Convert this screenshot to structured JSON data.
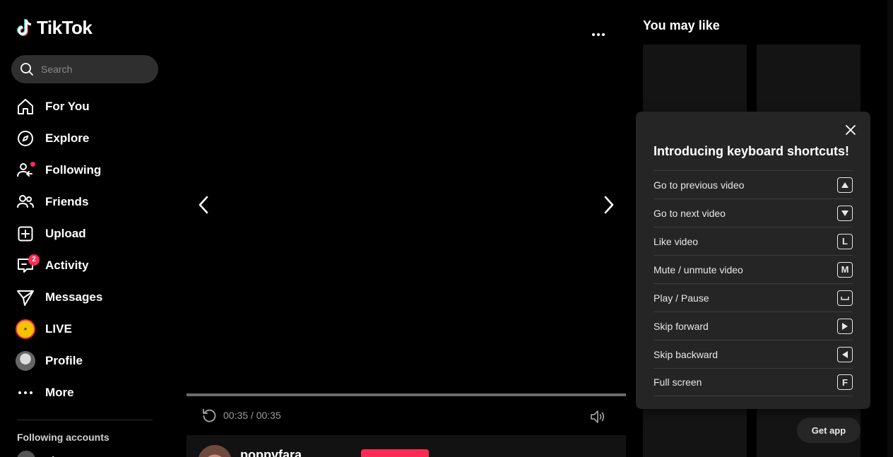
{
  "app": {
    "name": "TikTok"
  },
  "search": {
    "placeholder": "Search"
  },
  "nav": [
    {
      "label": "For You",
      "icon": "home-icon"
    },
    {
      "label": "Explore",
      "icon": "compass-icon"
    },
    {
      "label": "Following",
      "icon": "following-icon"
    },
    {
      "label": "Friends",
      "icon": "friends-icon"
    },
    {
      "label": "Upload",
      "icon": "upload-icon"
    },
    {
      "label": "Activity",
      "icon": "activity-icon",
      "badge": "2"
    },
    {
      "label": "Messages",
      "icon": "messages-icon"
    },
    {
      "label": "LIVE",
      "icon": "live-avatar"
    },
    {
      "label": "Profile",
      "icon": "profile-avatar"
    },
    {
      "label": "More",
      "icon": "more-icon"
    }
  ],
  "sidebar": {
    "following_title": "Following accounts",
    "following_first": "rajesa"
  },
  "video": {
    "time": "00:35 / 00:35",
    "progress_percent": 100
  },
  "author": {
    "name": "poppyfara"
  },
  "right": {
    "you_may_like": "You may like",
    "get_app": "Get app"
  },
  "shortcuts": {
    "title": "Introducing keyboard shortcuts!",
    "items": [
      {
        "label": "Go to previous video",
        "key": "▲"
      },
      {
        "label": "Go to next video",
        "key": "▼"
      },
      {
        "label": "Like video",
        "key": "L"
      },
      {
        "label": "Mute / unmute video",
        "key": "M"
      },
      {
        "label": "Play / Pause",
        "key": "⎵"
      },
      {
        "label": "Skip forward",
        "key": "▶"
      },
      {
        "label": "Skip backward",
        "key": "◀"
      },
      {
        "label": "Full screen",
        "key": "F"
      }
    ]
  },
  "colors": {
    "accent": "#fe2c55",
    "background": "#000000",
    "popup": "#252525"
  }
}
